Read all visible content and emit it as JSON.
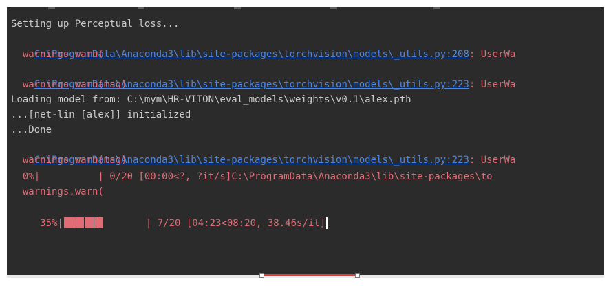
{
  "colors": {
    "background": "#2b2b2b",
    "text": "#c9c9c9",
    "warning": "#e06c75",
    "link": "#4a86e8"
  },
  "console": {
    "lines": [
      {
        "type": "plain",
        "text": "Setting up Perceptual loss..."
      },
      {
        "type": "link",
        "link": "C:\\ProgramData\\Anaconda3\\lib\\site-packages\\torchvision\\models\\_utils.py:208",
        "suffix": ": UserWa"
      },
      {
        "type": "warn",
        "text": "  warnings.warn("
      },
      {
        "type": "link",
        "link": "C:\\ProgramData\\Anaconda3\\lib\\site-packages\\torchvision\\models\\_utils.py:223",
        "suffix": ": UserWa"
      },
      {
        "type": "warn",
        "text": "  warnings.warn(msg)"
      },
      {
        "type": "plain",
        "text": "Loading model from: C:\\mym\\HR-VITON\\eval_models\\weights\\v0.1\\alex.pth"
      },
      {
        "type": "plain",
        "text": "...[net-lin [alex]] initialized"
      },
      {
        "type": "plain",
        "text": "...Done"
      },
      {
        "type": "link",
        "link": "C:\\ProgramData\\Anaconda3\\lib\\site-packages\\torchvision\\models\\_utils.py:223",
        "suffix": ": UserWa"
      },
      {
        "type": "warn",
        "text": "  warnings.warn(msg)"
      },
      {
        "type": "warn",
        "text": "  0%|          | 0/20 [00:00<?, ?it/s]C:\\ProgramData\\Anaconda3\\lib\\site-packages\\to"
      },
      {
        "type": "warn",
        "text": "  warnings.warn("
      }
    ],
    "progress": {
      "percent_label": " 35%|",
      "fraction": 0.35,
      "status": "| 7/20 [04:23<08:20, 38.46s/it]"
    }
  }
}
